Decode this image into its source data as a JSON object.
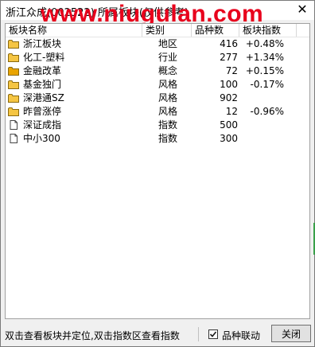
{
  "window": {
    "title": "浙江众成(002522) 所属板块(仅供参考)",
    "watermark": "www.niugulan.com",
    "close_glyph": "✕"
  },
  "table": {
    "headers": [
      "板块名称",
      "类别",
      "品种数",
      "板块指数"
    ],
    "rows": [
      {
        "icon": "folder-icon",
        "name": "浙江板块",
        "type": "地区",
        "count": "416",
        "index": "+0.48%"
      },
      {
        "icon": "folder-icon",
        "name": "化工-塑料",
        "type": "行业",
        "count": "277",
        "index": "+1.34%"
      },
      {
        "icon": "folder-filled-icon",
        "name": "金融改革",
        "type": "概念",
        "count": "72",
        "index": "+0.15%"
      },
      {
        "icon": "folder-icon",
        "name": "基金独门",
        "type": "风格",
        "count": "100",
        "index": "-0.17%"
      },
      {
        "icon": "folder-icon",
        "name": "深港通SZ",
        "type": "风格",
        "count": "902",
        "index": ""
      },
      {
        "icon": "folder-icon",
        "name": "昨曾涨停",
        "type": "风格",
        "count": "12",
        "index": "-0.96%"
      },
      {
        "icon": "document-icon",
        "name": "深证成指",
        "type": "指数",
        "count": "500",
        "index": ""
      },
      {
        "icon": "document-icon",
        "name": "中小300",
        "type": "指数",
        "count": "300",
        "index": ""
      }
    ]
  },
  "status": {
    "hint": "双击查看板块并定位,双击指数区查看指数",
    "checkbox_label": "品种联动",
    "checkbox_checked": true,
    "close_button": "关闭"
  },
  "colors": {
    "watermark": "#e8001c",
    "folder": "#f5c542",
    "folder_filled": "#e9a400"
  }
}
